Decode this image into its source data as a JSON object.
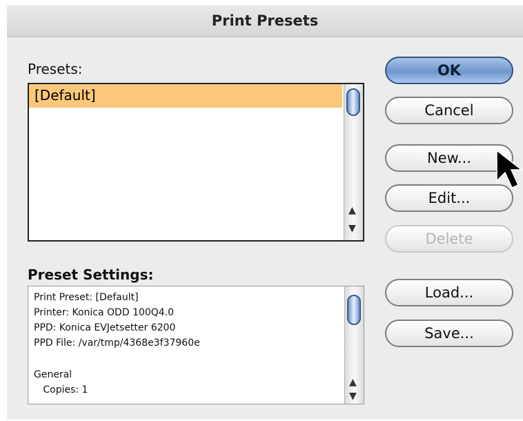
{
  "window": {
    "title": "Print Presets"
  },
  "presets": {
    "label": "Presets:",
    "items": [
      "[Default]"
    ],
    "selected_item": "[Default]"
  },
  "settings": {
    "label": "Preset Settings:",
    "lines": [
      "Print Preset: [Default]",
      "Printer: Konica ODD 100Q4.0",
      "PPD: Konica EVJetsetter 6200",
      "PPD File: /var/tmp/4368e3f37960e",
      "",
      "General",
      "   Copies: 1"
    ]
  },
  "buttons": {
    "ok": "OK",
    "cancel": "Cancel",
    "new": "New...",
    "edit": "Edit...",
    "delete": "Delete",
    "load": "Load...",
    "save": "Save..."
  },
  "colors": {
    "selection": "#fbc77a",
    "default_button": "#6f97cc",
    "disabled_text": "#b6b6b6"
  }
}
